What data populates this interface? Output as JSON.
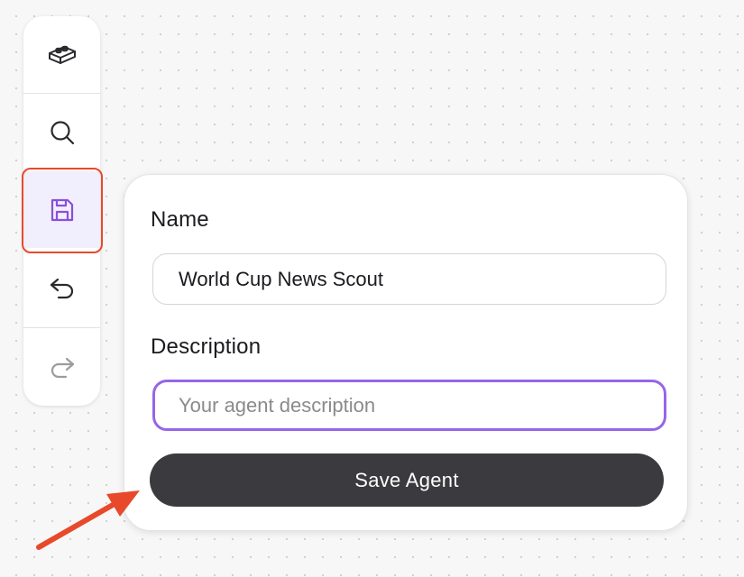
{
  "toolbar": {
    "items": [
      {
        "icon": "blocks-icon",
        "active": false
      },
      {
        "icon": "search-icon",
        "active": false
      },
      {
        "icon": "save-icon",
        "active": true
      },
      {
        "icon": "undo-icon",
        "active": false
      },
      {
        "icon": "redo-icon",
        "active": false,
        "disabled": true
      }
    ]
  },
  "save_panel": {
    "name_label": "Name",
    "name_value": "World Cup News Scout",
    "description_label": "Description",
    "description_value": "",
    "description_placeholder": "Your agent description",
    "save_button_label": "Save Agent"
  },
  "colors": {
    "accent": "#9765e8",
    "active_tab_bg": "#f1effd",
    "annotation": "#e8492a",
    "button_bg": "#3b3b3f"
  }
}
